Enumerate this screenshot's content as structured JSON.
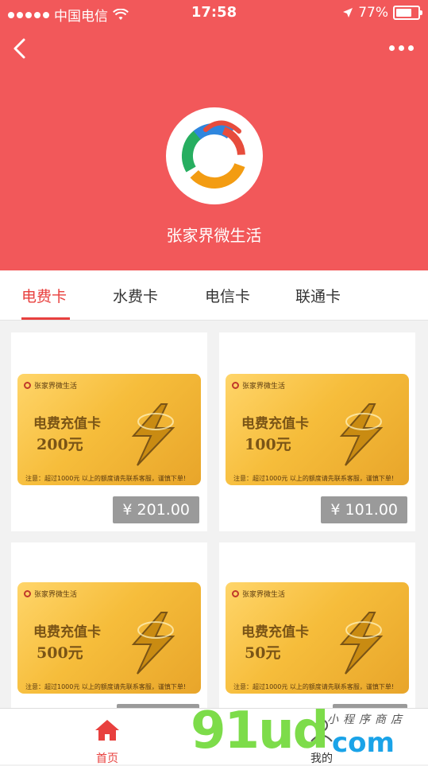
{
  "status_bar": {
    "carrier": "中国电信",
    "time": "17:58",
    "battery": "77%",
    "battery_level": 0.77
  },
  "header": {
    "shop_name": "张家界微生活",
    "bg_color": "#f2585a"
  },
  "tabs": [
    {
      "label": "电费卡",
      "active": true
    },
    {
      "label": "水费卡",
      "active": false
    },
    {
      "label": "电信卡",
      "active": false
    },
    {
      "label": "联通卡",
      "active": false
    }
  ],
  "products": [
    {
      "brand": "张家界微生活",
      "title": "电费充值卡",
      "amount": "200元",
      "note": "注意：超过1000元 以上的额度请先联系客服，谨慎下单!",
      "price": "¥ 201.00"
    },
    {
      "brand": "张家界微生活",
      "title": "电费充值卡",
      "amount": "100元",
      "note": "注意：超过1000元 以上的额度请先联系客服，谨慎下单!",
      "price": "¥ 101.00"
    },
    {
      "brand": "张家界微生活",
      "title": "电费充值卡",
      "amount": "500元",
      "note": "注意：超过1000元 以上的额度请先联系客服，谨慎下单!",
      "price": ""
    },
    {
      "brand": "张家界微生活",
      "title": "电费充值卡",
      "amount": "50元",
      "note": "注意：超过1000元 以上的额度请先联系客服，谨慎下单!",
      "price": ""
    }
  ],
  "bottom_nav": {
    "home_label": "首页",
    "mine_label": "我的",
    "active_color": "#e8403e"
  },
  "watermark": {
    "big": "91ud",
    "com": "com",
    "small": "小程序商店"
  }
}
